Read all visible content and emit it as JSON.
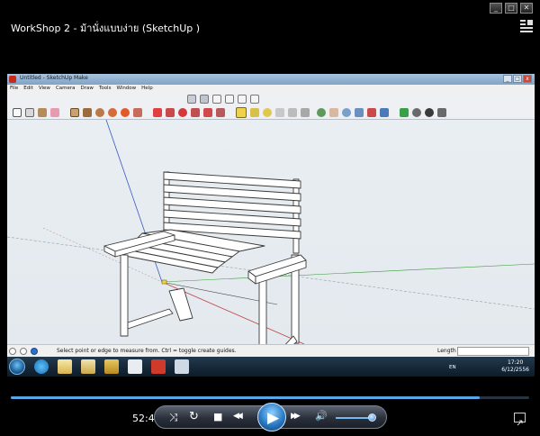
{
  "player": {
    "title": "WorkShop 2 - ม้านั่งแบบง่าย (SketchUp )",
    "controls": {
      "time": "52:46",
      "shuffle_label": "⤨",
      "repeat_label": "↻",
      "stop_label": "■",
      "prev_label": "◀◀",
      "play_label": "▶",
      "next_label": "▶▶",
      "mute_label": "🔊",
      "seek_progress": 0.905,
      "volume_level": 0.9
    }
  },
  "sketchup": {
    "window_title": "Untitled - SketchUp Make",
    "menu": [
      "File",
      "Edit",
      "View",
      "Camera",
      "Draw",
      "Tools",
      "Window",
      "Help"
    ],
    "status_text": "Select point or edge to measure from.  Ctrl = toggle create guides.",
    "measurements_label": "Length",
    "measurements_value": ""
  },
  "taskbar": {
    "language": "EN",
    "clock_time": "17:20",
    "clock_date": "6/12/2556"
  },
  "colors": {
    "seek_fill": "#5aa7e8",
    "sky": "#e8eef2",
    "bench_face": "#ffffff",
    "bench_edge": "#3a3a3a",
    "axis_red": "#c04040",
    "axis_green": "#3c9a3c",
    "axis_blue": "#4a6fc8"
  }
}
